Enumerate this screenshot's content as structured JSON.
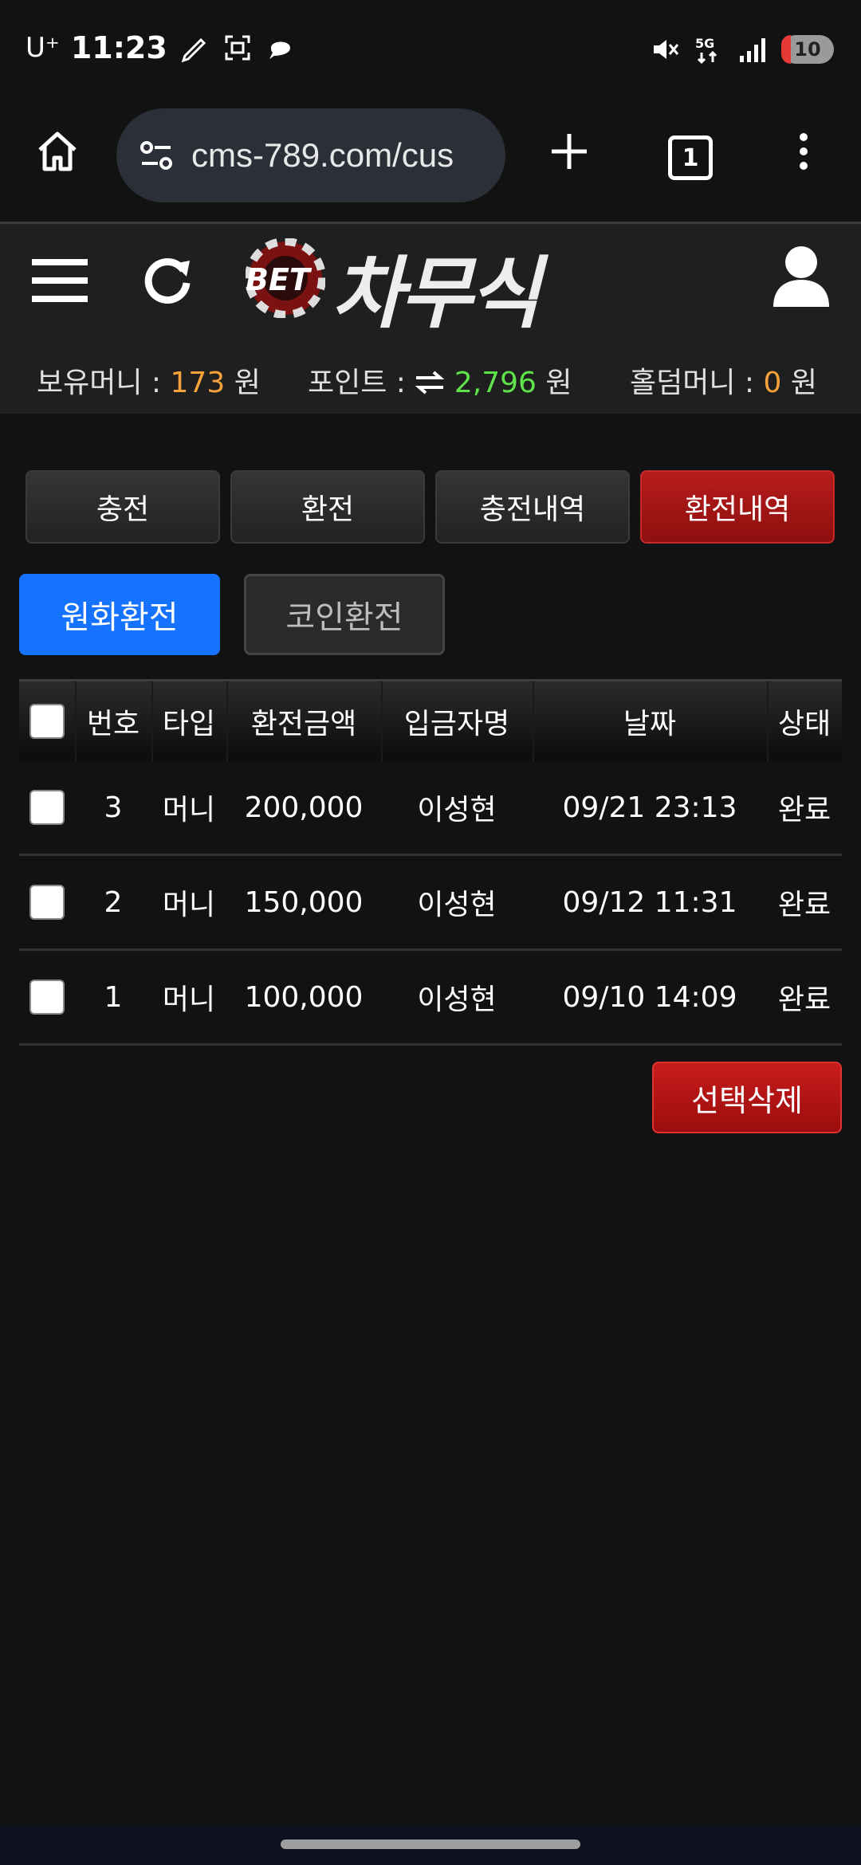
{
  "status_bar": {
    "carrier": "U⁺",
    "time": "11:23",
    "battery": "10"
  },
  "browser": {
    "url": "cms-789.com/cus",
    "tab_count": "1"
  },
  "site": {
    "logo_small": "BET",
    "logo_main": "차무식",
    "money": {
      "label": "보유머니 :",
      "value": "173",
      "unit": "원"
    },
    "points": {
      "label": "포인트 :",
      "value": "2,796",
      "unit": "원"
    },
    "holdem": {
      "label": "홀덤머니 :",
      "value": "0",
      "unit": "원"
    }
  },
  "tabs": [
    {
      "label": "충전"
    },
    {
      "label": "환전"
    },
    {
      "label": "충전내역"
    },
    {
      "label": "환전내역"
    }
  ],
  "subtabs": [
    {
      "label": "원화환전"
    },
    {
      "label": "코인환전"
    }
  ],
  "table": {
    "headers": [
      "번호",
      "타입",
      "환전금액",
      "입금자명",
      "날짜",
      "상태"
    ],
    "rows": [
      {
        "no": "3",
        "type": "머니",
        "amount": "200,000",
        "name": "이성현",
        "date": "09/21 23:13",
        "status": "완료"
      },
      {
        "no": "2",
        "type": "머니",
        "amount": "150,000",
        "name": "이성현",
        "date": "09/12 11:31",
        "status": "완료"
      },
      {
        "no": "1",
        "type": "머니",
        "amount": "100,000",
        "name": "이성현",
        "date": "09/10 14:09",
        "status": "완료"
      }
    ]
  },
  "delete_button": "선택삭제",
  "colors": {
    "accent_red": "#b71c1c",
    "accent_blue": "#1673ff",
    "money_orange": "#f7a23b",
    "point_green": "#5fe34a"
  }
}
